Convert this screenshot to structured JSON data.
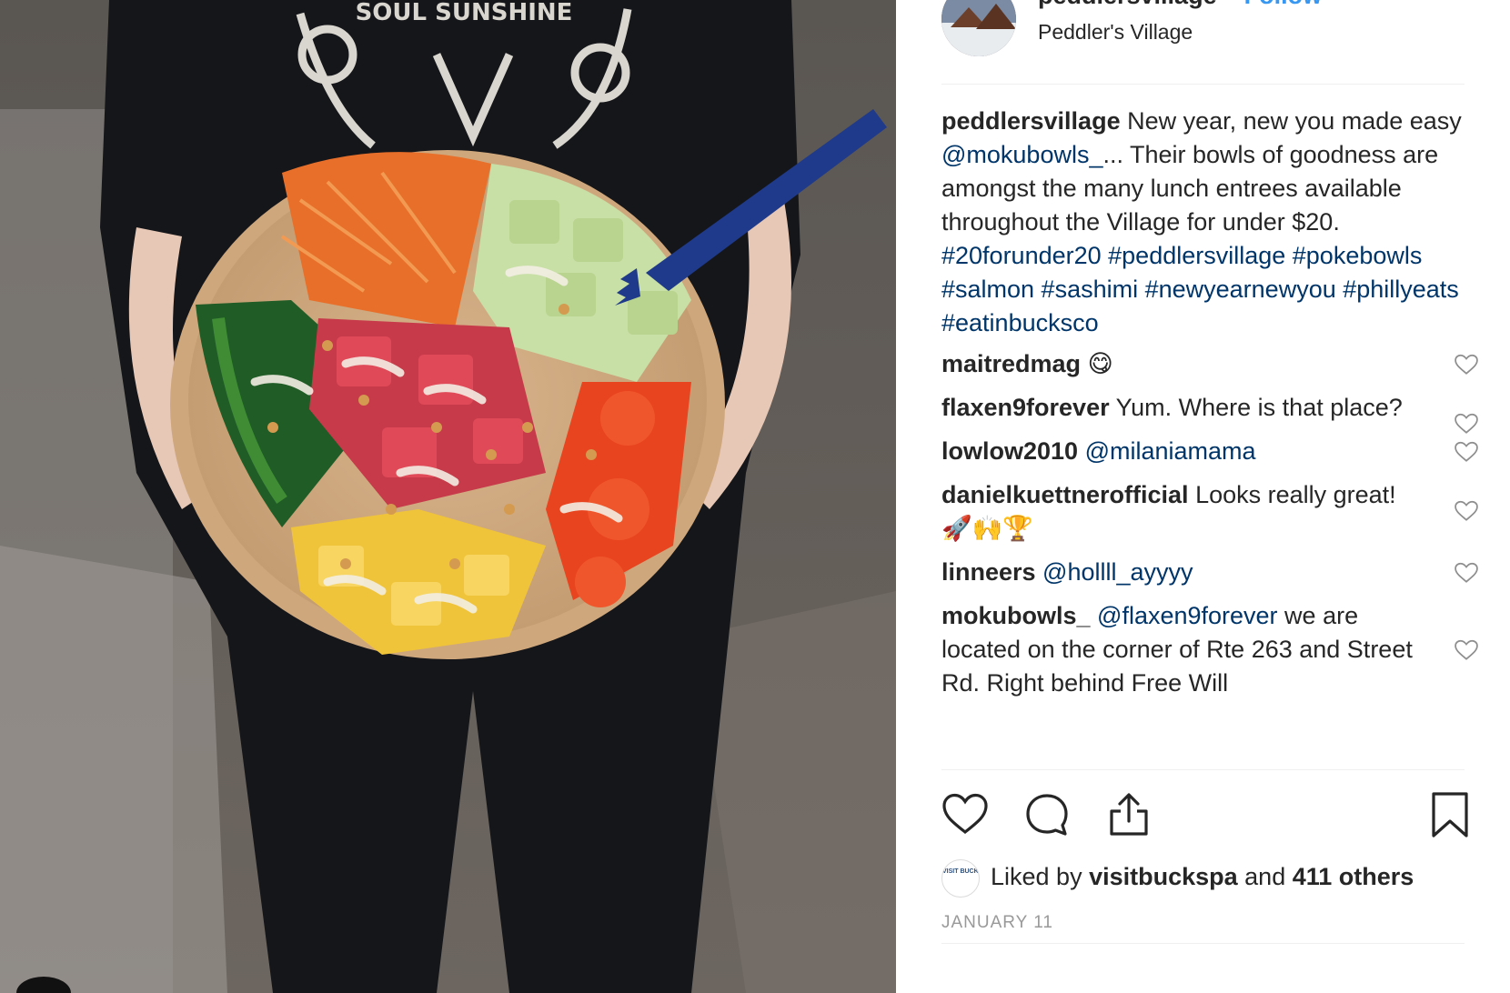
{
  "post": {
    "author": "peddlersvillage",
    "follow_label": "Follow",
    "location": "Peddler's Village",
    "photo": {
      "shirt_text": "SOUL SUNSHINE"
    }
  },
  "caption": {
    "user": "peddlersvillage",
    "text_1": " New year, new you made easy ",
    "mention": "@mokubowls_",
    "text_2": "... Their bowls of goodness are amongst the many lunch entrees available throughout the Village for under $20.",
    "hashtags": "#20forunder20 #peddlersvillage #pokebowls #salmon #sashimi #newyearnewyou #phillyeats #eatinbucksco"
  },
  "comments": [
    {
      "user": "maitredmag",
      "mention": "",
      "text": " 😋"
    },
    {
      "user": "flaxen9forever",
      "mention": "",
      "text": " Yum. Where is that place?"
    },
    {
      "user": "lowlow2010",
      "mention": " @milaniamama",
      "text": ""
    },
    {
      "user": "danielkuettnerofficial",
      "mention": "",
      "text": " Looks really great! 🚀🙌🏆"
    },
    {
      "user": "linneers",
      "mention": " @hollll_ayyyy",
      "text": ""
    },
    {
      "user": "mokubowls_",
      "mention": " @flaxen9forever",
      "text": " we are located on the corner of Rte 263 and Street Rd. Right behind Free Will"
    }
  ],
  "likes": {
    "avatar_text": "VISIT BUCKS COUNTY",
    "prefix": "Liked by ",
    "user": "visitbuckspa",
    "mid": " and ",
    "others": "411 others"
  },
  "date": "JANUARY 11",
  "colors": {
    "link": "#003569",
    "follow": "#3897f0",
    "text": "#262626",
    "muted": "#999999"
  },
  "icons": [
    "heart-icon",
    "comment-icon",
    "share-icon",
    "bookmark-icon"
  ]
}
